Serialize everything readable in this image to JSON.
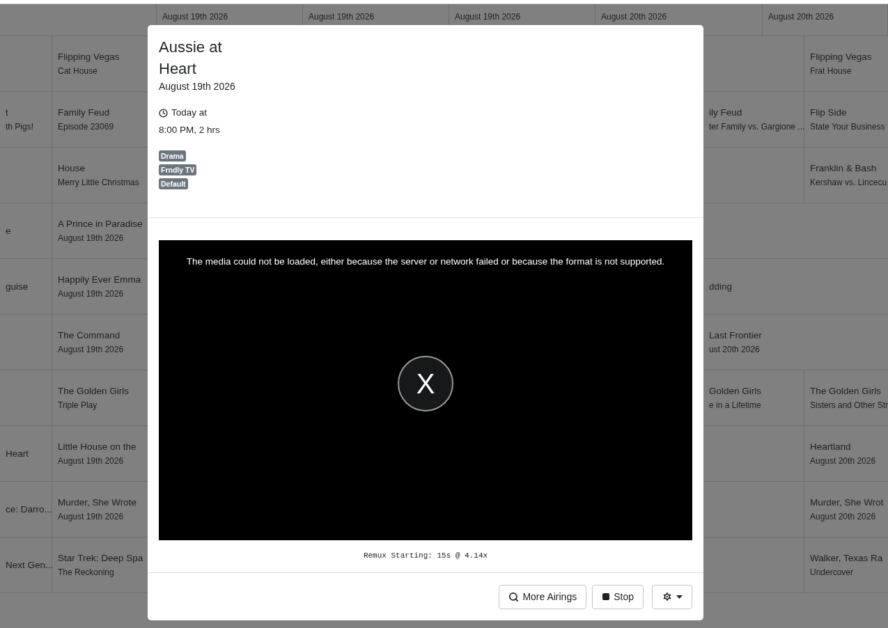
{
  "guide": {
    "top_row": [
      "August 19th 2026",
      "August 19th 2026",
      "August 19th 2026",
      "August 20th 2026",
      "August 20th 2026"
    ],
    "rows": [
      {
        "middle": {
          "title": "Flipping Vegas",
          "subtitle": "Cat House"
        },
        "right": {},
        "far_right": {
          "title": "Flipping Vegas",
          "subtitle": "Frat House"
        }
      },
      {
        "left": {
          "title": "t",
          "subtitle": "th Pigs!"
        },
        "middle": {
          "title": "Family Feud",
          "subtitle": "Episode 23069"
        },
        "right": {
          "title": "ily Feud",
          "subtitle": "ter Family vs. Gargione ..."
        },
        "far_right": {
          "title": "Flip Side",
          "subtitle": "State Your Business"
        }
      },
      {
        "middle": {
          "title": "House",
          "subtitle": "Merry Little Christmas"
        },
        "right": {},
        "far_right": {
          "title": "Franklin & Bash",
          "subtitle": "Kershaw vs. Lincecu"
        }
      },
      {
        "left": {
          "title": "e"
        },
        "middle": {
          "title": "A Prince in Paradise",
          "subtitle": "August 19th 2026"
        },
        "right": {}
      },
      {
        "left": {
          "title": "guise"
        },
        "middle": {
          "title": "Happily Ever Emma",
          "subtitle": "August 19th 2026"
        },
        "right": {
          "title": "dding"
        }
      },
      {
        "middle": {
          "title": "The Command",
          "subtitle": "August 19th 2026"
        },
        "right": {
          "title": "Last Frontier",
          "subtitle": "ust 20th 2026"
        }
      },
      {
        "middle": {
          "title": "The Golden Girls",
          "subtitle": "Triple Play"
        },
        "right": {
          "title": "Golden Girls",
          "subtitle": "e in a Lifetime"
        },
        "far_right": {
          "title": "The Golden Girls",
          "subtitle": "Sisters and Other Str"
        }
      },
      {
        "left": {
          "title": "Heart"
        },
        "middle": {
          "title": "Little House on the",
          "subtitle": "August 19th 2026"
        },
        "right": {},
        "far_right": {
          "title": "Heartland",
          "subtitle": "August 20th 2026"
        }
      },
      {
        "left": {
          "title": "ce: Darro..."
        },
        "middle": {
          "title": "Murder, She Wrote",
          "subtitle": "August 19th 2026"
        },
        "right": {},
        "far_right": {
          "title": "Murder, She Wrot",
          "subtitle": "August 20th 2026"
        }
      },
      {
        "left": {
          "title": "Next Gen..."
        },
        "middle": {
          "title": "Star Trek: Deep Spa",
          "subtitle": "The Reckoning"
        },
        "right": {},
        "far_right": {
          "title": "Walker, Texas Ra",
          "subtitle": "Undercover"
        }
      }
    ]
  },
  "modal": {
    "title": "Aussie at Heart",
    "date": "August 19th 2026",
    "time_line_1": "Today at",
    "time_line_2": "8:00 PM, 2 hrs",
    "tags": [
      "Drama",
      "Frndly TV",
      "Default"
    ],
    "player": {
      "error": "The media could not be loaded, either because the server or network failed or because the format is not supported.",
      "button_label": "X"
    },
    "status": "Remux Starting: 15s @ 4.14x",
    "buttons": [
      {
        "kind": "search",
        "label": "More Airings"
      },
      {
        "kind": "stop",
        "label": "Stop"
      },
      {
        "kind": "settings"
      }
    ]
  }
}
